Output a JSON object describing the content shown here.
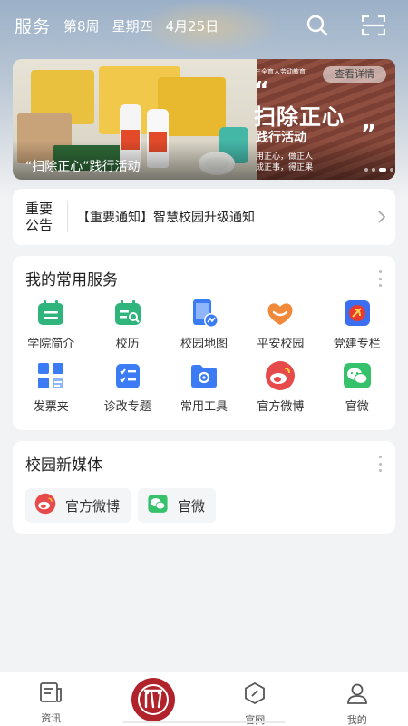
{
  "header": {
    "title": "服务",
    "week": "第8周",
    "weekday": "星期四",
    "date": "4月25日",
    "search_icon": "search-icon",
    "scan_icon": "scan-icon"
  },
  "banner": {
    "caption": "“扫除正心”践行活动",
    "detail_button": "查看详情",
    "org": "三全育人劳动教育",
    "headline": "扫除正心",
    "subline": "践行活动",
    "motto1": "用正心，做正人",
    "motto2": "成正事，得正果",
    "quote_open": "“",
    "quote_close": "”"
  },
  "notice": {
    "tag": "重要公告",
    "text": "【重要通知】智慧校园升级通知"
  },
  "services": {
    "title": "我的常用服务",
    "items": [
      {
        "label": "学院简介",
        "icon": "college-intro-icon",
        "color": "#2fb57c"
      },
      {
        "label": "校历",
        "icon": "calendar-icon",
        "color": "#2fb57c"
      },
      {
        "label": "校园地图",
        "icon": "campus-map-icon",
        "color": "#3b7cf5"
      },
      {
        "label": "平安校园",
        "icon": "safe-campus-icon",
        "color": "#f08a3a"
      },
      {
        "label": "党建专栏",
        "icon": "party-building-icon",
        "color": "#3b6ff0"
      },
      {
        "label": "发票夹",
        "icon": "invoice-folder-icon",
        "color": "#3b7cf5"
      },
      {
        "label": "诊改专题",
        "icon": "diagnosis-topic-icon",
        "color": "#3b7cf5"
      },
      {
        "label": "常用工具",
        "icon": "tools-folder-icon",
        "color": "#3b7cf5"
      },
      {
        "label": "官方微博",
        "icon": "weibo-icon",
        "color": "#e64a4a"
      },
      {
        "label": "官微",
        "icon": "wechat-icon",
        "color": "#35c26b"
      }
    ]
  },
  "media": {
    "title": "校园新媒体",
    "items": [
      {
        "label": "官方微博",
        "icon": "weibo-icon"
      },
      {
        "label": "官微",
        "icon": "wechat-icon"
      }
    ]
  },
  "tabbar": {
    "tabs": [
      {
        "label": "资讯",
        "icon": "news-icon"
      },
      {
        "label": "",
        "icon": "school-logo-icon"
      },
      {
        "label": "官网",
        "icon": "website-icon"
      },
      {
        "label": "我的",
        "icon": "profile-icon"
      }
    ]
  }
}
